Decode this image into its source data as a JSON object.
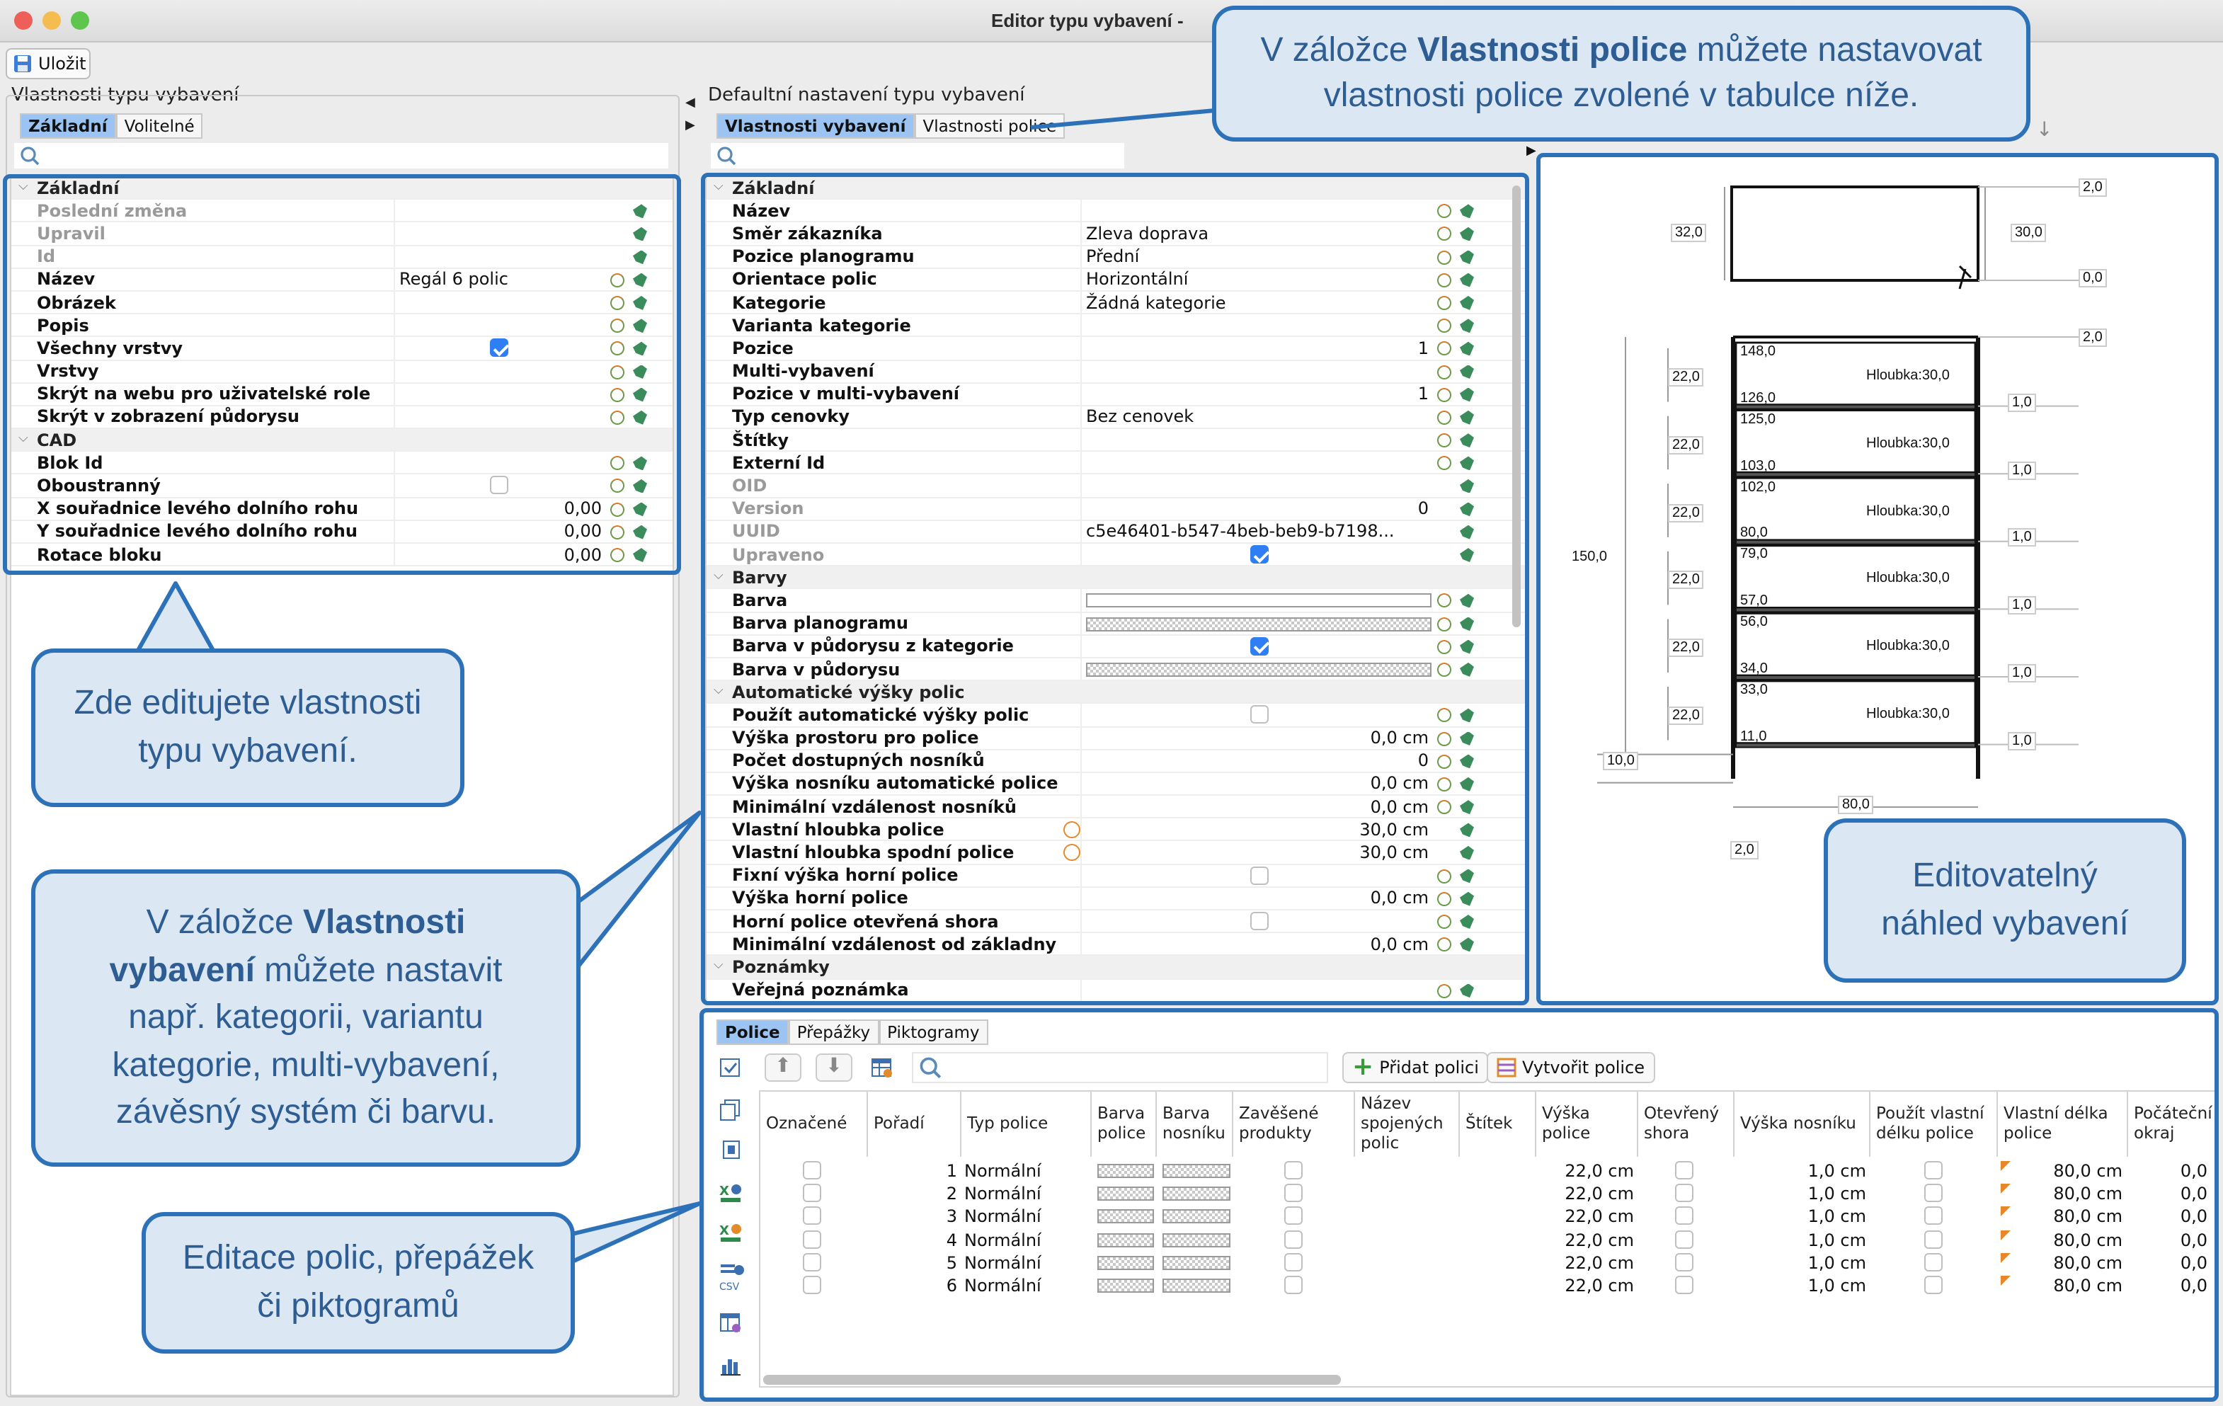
{
  "window": {
    "title": "Editor typu vybavení -"
  },
  "toolbar": {
    "save_label": "Uložit"
  },
  "left": {
    "group_title": "Vlastnosti typu vybavení",
    "tabs": [
      "Základní",
      "Volitelné"
    ],
    "sections": {
      "basic": "Základní",
      "cad": "CAD"
    },
    "props": [
      {
        "name": "Poslední změna",
        "value": ""
      },
      {
        "name": "Upravil",
        "value": ""
      },
      {
        "name": "Id",
        "value": ""
      },
      {
        "name": "Název",
        "value": "Regál 6 polic"
      },
      {
        "name": "Obrázek",
        "value": ""
      },
      {
        "name": "Popis",
        "value": ""
      },
      {
        "name": "Všechny vrstvy",
        "value": ""
      },
      {
        "name": "Vrstvy",
        "value": ""
      },
      {
        "name": "Skrýt na webu pro uživatelské role",
        "value": ""
      },
      {
        "name": "Skrýt v zobrazení půdorysu",
        "value": ""
      },
      {
        "name": "Blok Id",
        "value": ""
      },
      {
        "name": "Oboustranný",
        "value": ""
      },
      {
        "name": "X souřadnice levého dolního rohu",
        "value": "0,00"
      },
      {
        "name": "Y souřadnice levého dolního rohu",
        "value": "0,00"
      },
      {
        "name": "Rotace bloku",
        "value": "0,00"
      }
    ]
  },
  "middle": {
    "group_title": "Defaultní nastavení typu vybavení",
    "tabs": [
      "Vlastnosti vybavení",
      "Vlastnosti police"
    ],
    "sections": {
      "basic": "Základní",
      "colors": "Barvy",
      "auto": "Automatické výšky polic",
      "notes": "Poznámky"
    },
    "props": [
      {
        "name": "Název",
        "value": ""
      },
      {
        "name": "Směr zákazníka",
        "value": "Zleva doprava"
      },
      {
        "name": "Pozice planogramu",
        "value": "Přední"
      },
      {
        "name": "Orientace polic",
        "value": "Horizontální"
      },
      {
        "name": "Kategorie",
        "value": "Žádná kategorie"
      },
      {
        "name": "Varianta kategorie",
        "value": ""
      },
      {
        "name": "Pozice",
        "value": "1"
      },
      {
        "name": "Multi-vybavení",
        "value": ""
      },
      {
        "name": "Pozice v multi-vybavení",
        "value": "1"
      },
      {
        "name": "Typ cenovky",
        "value": "Bez cenovek"
      },
      {
        "name": "Štítky",
        "value": ""
      },
      {
        "name": "Externí Id",
        "value": ""
      },
      {
        "name": "OID",
        "value": ""
      },
      {
        "name": "Version",
        "value": "0"
      },
      {
        "name": "UUID",
        "value": "c5e46401-b547-4beb-beb9-b7198..."
      },
      {
        "name": "Upraveno",
        "value": ""
      },
      {
        "name": "Barva",
        "value": ""
      },
      {
        "name": "Barva planogramu",
        "value": ""
      },
      {
        "name": "Barva v půdorysu z kategorie",
        "value": ""
      },
      {
        "name": "Barva v půdorysu",
        "value": ""
      },
      {
        "name": "Použít automatické výšky polic",
        "value": ""
      },
      {
        "name": "Výška prostoru pro police",
        "value": "0,0 cm"
      },
      {
        "name": "Počet dostupných nosníků",
        "value": "0"
      },
      {
        "name": "Výška nosníku automatické police",
        "value": "0,0 cm"
      },
      {
        "name": "Minimální vzdálenost nosníků",
        "value": "0,0 cm"
      },
      {
        "name": "Vlastní hloubka police",
        "value": "30,0 cm"
      },
      {
        "name": "Vlastní hloubka spodní police",
        "value": "30,0 cm"
      },
      {
        "name": "Fixní výška horní police",
        "value": ""
      },
      {
        "name": "Výška horní police",
        "value": "0,0 cm"
      },
      {
        "name": "Horní police otevřená shora",
        "value": ""
      },
      {
        "name": "Minimální vzdálenost od základny",
        "value": "0,0 cm"
      },
      {
        "name": "Veřejná poznámka",
        "value": ""
      }
    ]
  },
  "preview": {
    "top": {
      "left": "32,0",
      "right": "30,0",
      "tr": "2,0",
      "br": "0,0"
    },
    "height_total": "150,0",
    "top_gap": "2,0",
    "shelves": [
      {
        "top": "148,0",
        "bottom": "126,0",
        "h": "22,0",
        "depth": "Hloubka:30,0",
        "beam": "1,0"
      },
      {
        "top": "125,0",
        "bottom": "103,0",
        "h": "22,0",
        "depth": "Hloubka:30,0",
        "beam": "1,0"
      },
      {
        "top": "102,0",
        "bottom": "80,0",
        "h": "22,0",
        "depth": "Hloubka:30,0",
        "beam": "1,0"
      },
      {
        "top": "79,0",
        "bottom": "57,0",
        "h": "22,0",
        "depth": "Hloubka:30,0",
        "beam": "1,0"
      },
      {
        "top": "56,0",
        "bottom": "34,0",
        "h": "22,0",
        "depth": "Hloubka:30,0",
        "beam": "1,0"
      },
      {
        "top": "33,0",
        "bottom": "11,0",
        "h": "22,0",
        "depth": "Hloubka:30,0",
        "beam": "1,0"
      }
    ],
    "base": "10,0",
    "width": "80,0",
    "bottom": "2,0"
  },
  "bottom": {
    "tabs": [
      "Police",
      "Přepážky",
      "Piktogramy"
    ],
    "add_shelf": "Přidat polici",
    "create_shelves": "Vytvořit police",
    "columns": [
      "Označené",
      "Pořadí",
      "Typ police",
      "Barva police",
      "Barva nosníku",
      "Zavěšené produkty",
      "Název spojených polic",
      "Štítek",
      "Výška police",
      "Otevřený shora",
      "Výška nosníku",
      "Použít vlastní délku police",
      "Vlastní délka police",
      "Počáteční okraj"
    ],
    "rows": [
      {
        "order": "1",
        "type": "Normální",
        "height": "22,0 cm",
        "beam": "1,0 cm",
        "length": "80,0 cm",
        "margin": "0,0"
      },
      {
        "order": "2",
        "type": "Normální",
        "height": "22,0 cm",
        "beam": "1,0 cm",
        "length": "80,0 cm",
        "margin": "0,0"
      },
      {
        "order": "3",
        "type": "Normální",
        "height": "22,0 cm",
        "beam": "1,0 cm",
        "length": "80,0 cm",
        "margin": "0,0"
      },
      {
        "order": "4",
        "type": "Normální",
        "height": "22,0 cm",
        "beam": "1,0 cm",
        "length": "80,0 cm",
        "margin": "0,0"
      },
      {
        "order": "5",
        "type": "Normální",
        "height": "22,0 cm",
        "beam": "1,0 cm",
        "length": "80,0 cm",
        "margin": "0,0"
      },
      {
        "order": "6",
        "type": "Normální",
        "height": "22,0 cm",
        "beam": "1,0 cm",
        "length": "80,0 cm",
        "margin": "0,0"
      }
    ]
  },
  "callouts": {
    "top": {
      "pre": "V záložce ",
      "bold": "Vlastnosti police",
      "post": " můžete nastavovat vlastnosti police zvolené v tabulce níže."
    },
    "left_top": "Zde editujete vlastnosti typu vybavení.",
    "left_mid": {
      "pre": "V záložce ",
      "bold": "Vlastnosti vybavení",
      "post": " můžete nastavit např. kategorii, variantu kategorie, multi-vybavení, závěsný systém či barvu."
    },
    "left_bottom": "Editace polic, přepážek či piktogramů",
    "preview": "Editovatelný náhled vybavení"
  },
  "colors": {
    "accent": "#2d72b8",
    "callout_bg": "#dbe7f2",
    "tab_selected": "#9cc4f2"
  }
}
